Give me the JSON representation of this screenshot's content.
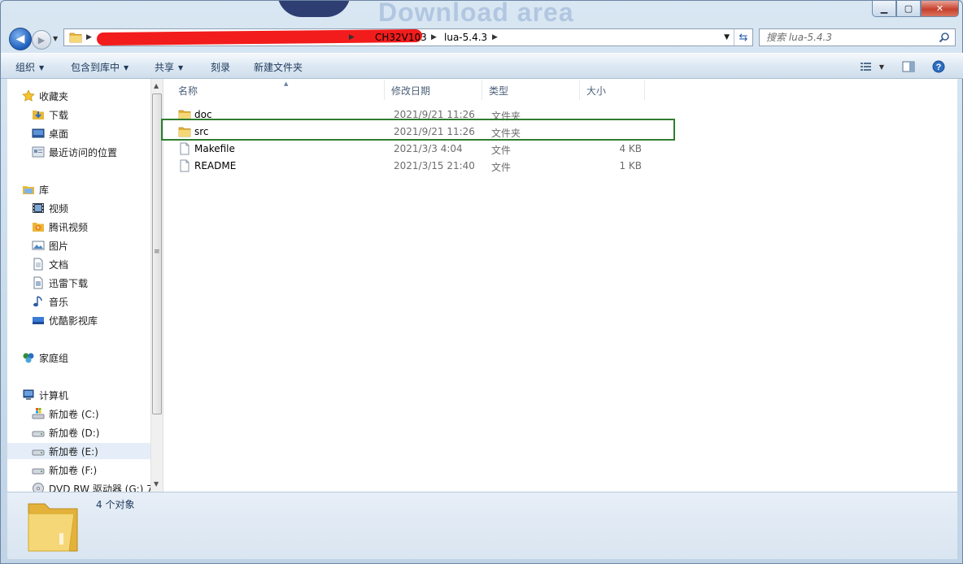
{
  "window": {
    "title": "Download area"
  },
  "nav_buttons": {
    "back": "◀",
    "forward": "▶"
  },
  "address": {
    "crumbs": [
      "CH32V103",
      "lua-5.4.3"
    ]
  },
  "search": {
    "placeholder": "搜索 lua-5.4.3"
  },
  "toolbar": {
    "organize": "组织",
    "include_in_library": "包含到库中",
    "share": "共享",
    "burn": "刻录",
    "new_folder": "新建文件夹"
  },
  "sidebar": {
    "favorites": {
      "label": "收藏夹",
      "items": [
        "下载",
        "桌面",
        "最近访问的位置"
      ]
    },
    "libraries": {
      "label": "库",
      "items": [
        "视频",
        "腾讯视频",
        "图片",
        "文档",
        "迅雷下载",
        "音乐",
        "优酷影视库"
      ]
    },
    "homegroup": {
      "label": "家庭组"
    },
    "computer": {
      "label": "计算机",
      "items": [
        "新加卷 (C:)",
        "新加卷 (D:)",
        "新加卷 (E:)",
        "新加卷 (F:)",
        "DVD RW 驱动器 (G:) 7"
      ],
      "selected_index": 2
    }
  },
  "columns": {
    "name": "名称",
    "date": "修改日期",
    "type": "类型",
    "size": "大小"
  },
  "files": [
    {
      "name": "doc",
      "date": "2021/9/21 11:26",
      "type": "文件夹",
      "size": "",
      "kind": "folder"
    },
    {
      "name": "src",
      "date": "2021/9/21 11:26",
      "type": "文件夹",
      "size": "",
      "kind": "folder"
    },
    {
      "name": "Makefile",
      "date": "2021/3/3 4:04",
      "type": "文件",
      "size": "4 KB",
      "kind": "file"
    },
    {
      "name": "README",
      "date": "2021/3/15 21:40",
      "type": "文件",
      "size": "1 KB",
      "kind": "file"
    }
  ],
  "details": {
    "count": "4 个对象"
  },
  "colors": {
    "highlight_border": "#2f7d2f",
    "redaction": "#f21c1c",
    "folder_yellow": "#f2c94c"
  }
}
